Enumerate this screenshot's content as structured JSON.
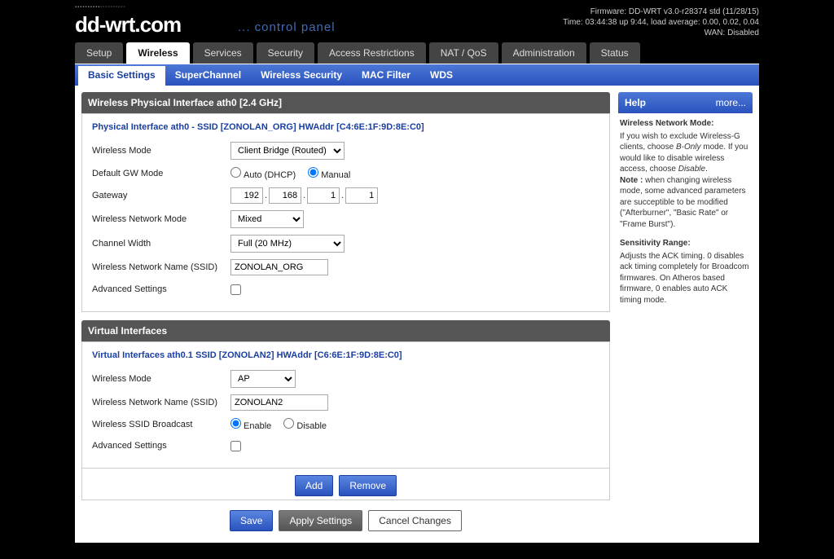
{
  "status": {
    "firmware": "Firmware: DD-WRT v3.0-r28374 std (11/28/15)",
    "time": "Time: 03:44:38 up 9:44, load average: 0.00, 0.02, 0.04",
    "wan": "WAN: Disabled"
  },
  "logo": {
    "left": "dd-wrt",
    "right": ".com",
    "subtitle": "... control panel"
  },
  "tabs": [
    "Setup",
    "Wireless",
    "Services",
    "Security",
    "Access Restrictions",
    "NAT / QoS",
    "Administration",
    "Status"
  ],
  "active_tab": "Wireless",
  "subtabs": [
    "Basic Settings",
    "SuperChannel",
    "Wireless Security",
    "MAC Filter",
    "WDS"
  ],
  "active_subtab": "Basic Settings",
  "phy": {
    "panel_title": "Wireless Physical Interface ath0 [2.4 GHz]",
    "legend": "Physical Interface ath0 - SSID [ZONOLAN_ORG] HWAddr [C4:6E:1F:9D:8E:C0]",
    "labels": {
      "mode": "Wireless Mode",
      "gwmode": "Default GW Mode",
      "gateway": "Gateway",
      "netmode": "Wireless Network Mode",
      "chwidth": "Channel Width",
      "ssid": "Wireless Network Name (SSID)",
      "adv": "Advanced Settings"
    },
    "values": {
      "mode": "Client Bridge (Routed)",
      "gw_auto": "Auto (DHCP)",
      "gw_manual": "Manual",
      "gateway_octets": [
        "192",
        "168",
        "1",
        "1"
      ],
      "netmode": "Mixed",
      "chwidth": "Full (20 MHz)",
      "ssid": "ZONOLAN_ORG"
    }
  },
  "virt": {
    "panel_title": "Virtual Interfaces",
    "legend": "Virtual Interfaces ath0.1 SSID [ZONOLAN2] HWAddr [C6:6E:1F:9D:8E:C0]",
    "labels": {
      "mode": "Wireless Mode",
      "ssid": "Wireless Network Name (SSID)",
      "bcast": "Wireless SSID Broadcast",
      "adv": "Advanced Settings",
      "enable": "Enable",
      "disable": "Disable"
    },
    "values": {
      "mode": "AP",
      "ssid": "ZONOLAN2"
    }
  },
  "buttons": {
    "add": "Add",
    "remove": "Remove",
    "save": "Save",
    "apply": "Apply Settings",
    "cancel": "Cancel Changes"
  },
  "help": {
    "title": "Help",
    "more": "more...",
    "mode_h": "Wireless Network Mode:",
    "mode_p1": "If you wish to exclude Wireless-G clients, choose ",
    "mode_em1": "B-Only",
    "mode_p2": " mode. If you would like to disable wireless access, choose ",
    "mode_em2": "Disable",
    "mode_p3": ".",
    "note_b": "Note : ",
    "note_p": "when changing wireless mode, some advanced parameters are succeptible to be modified (\"Afterburner\", \"Basic Rate\" or \"Frame Burst\").",
    "sens_h": "Sensitivity Range:",
    "sens_p": "Adjusts the ACK timing. 0 disables ack timing completely for Broadcom firmwares. On Atheros based firmware, 0 enables auto ACK timing mode."
  }
}
